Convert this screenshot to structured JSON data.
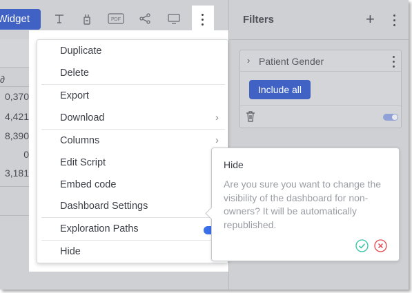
{
  "toolbar": {
    "widget_button_label": "Widget",
    "icons": [
      "text-icon",
      "widget-icon",
      "pdf-icon",
      "share-icon",
      "monitor-icon",
      "kebab-icon"
    ],
    "pdf_label": "PDF"
  },
  "table": {
    "header_fragment": "∂",
    "values": [
      "0,370",
      "4,421",
      "8,390",
      "0",
      "3,181"
    ]
  },
  "filters": {
    "title": "Filters",
    "add_icon": "plus-icon",
    "card": {
      "name": "Patient Gender",
      "include_label": "Include all"
    }
  },
  "menu": {
    "items": [
      {
        "label": "Duplicate"
      },
      {
        "label": "Delete"
      },
      {
        "label": "Export"
      },
      {
        "label": "Download",
        "submenu": true
      },
      {
        "label": "Columns",
        "submenu": true
      },
      {
        "label": "Edit Script"
      },
      {
        "label": "Embed code"
      },
      {
        "label": "Dashboard Settings"
      },
      {
        "label": "Exploration Paths",
        "toggle": true
      },
      {
        "label": "Hide"
      }
    ],
    "submenu_glyph": "›"
  },
  "popover": {
    "title": "Hide",
    "message": "Are you sure you want to change the visibility of the dashboard for non-owners? It will be automatically republished.",
    "confirm_icon": "check-circle-icon",
    "cancel_icon": "close-circle-icon"
  },
  "colors": {
    "accent": "#3f62c4",
    "toggle_on": "#3b6ee9",
    "confirm": "#2fc4a6",
    "cancel": "#e0454f"
  }
}
